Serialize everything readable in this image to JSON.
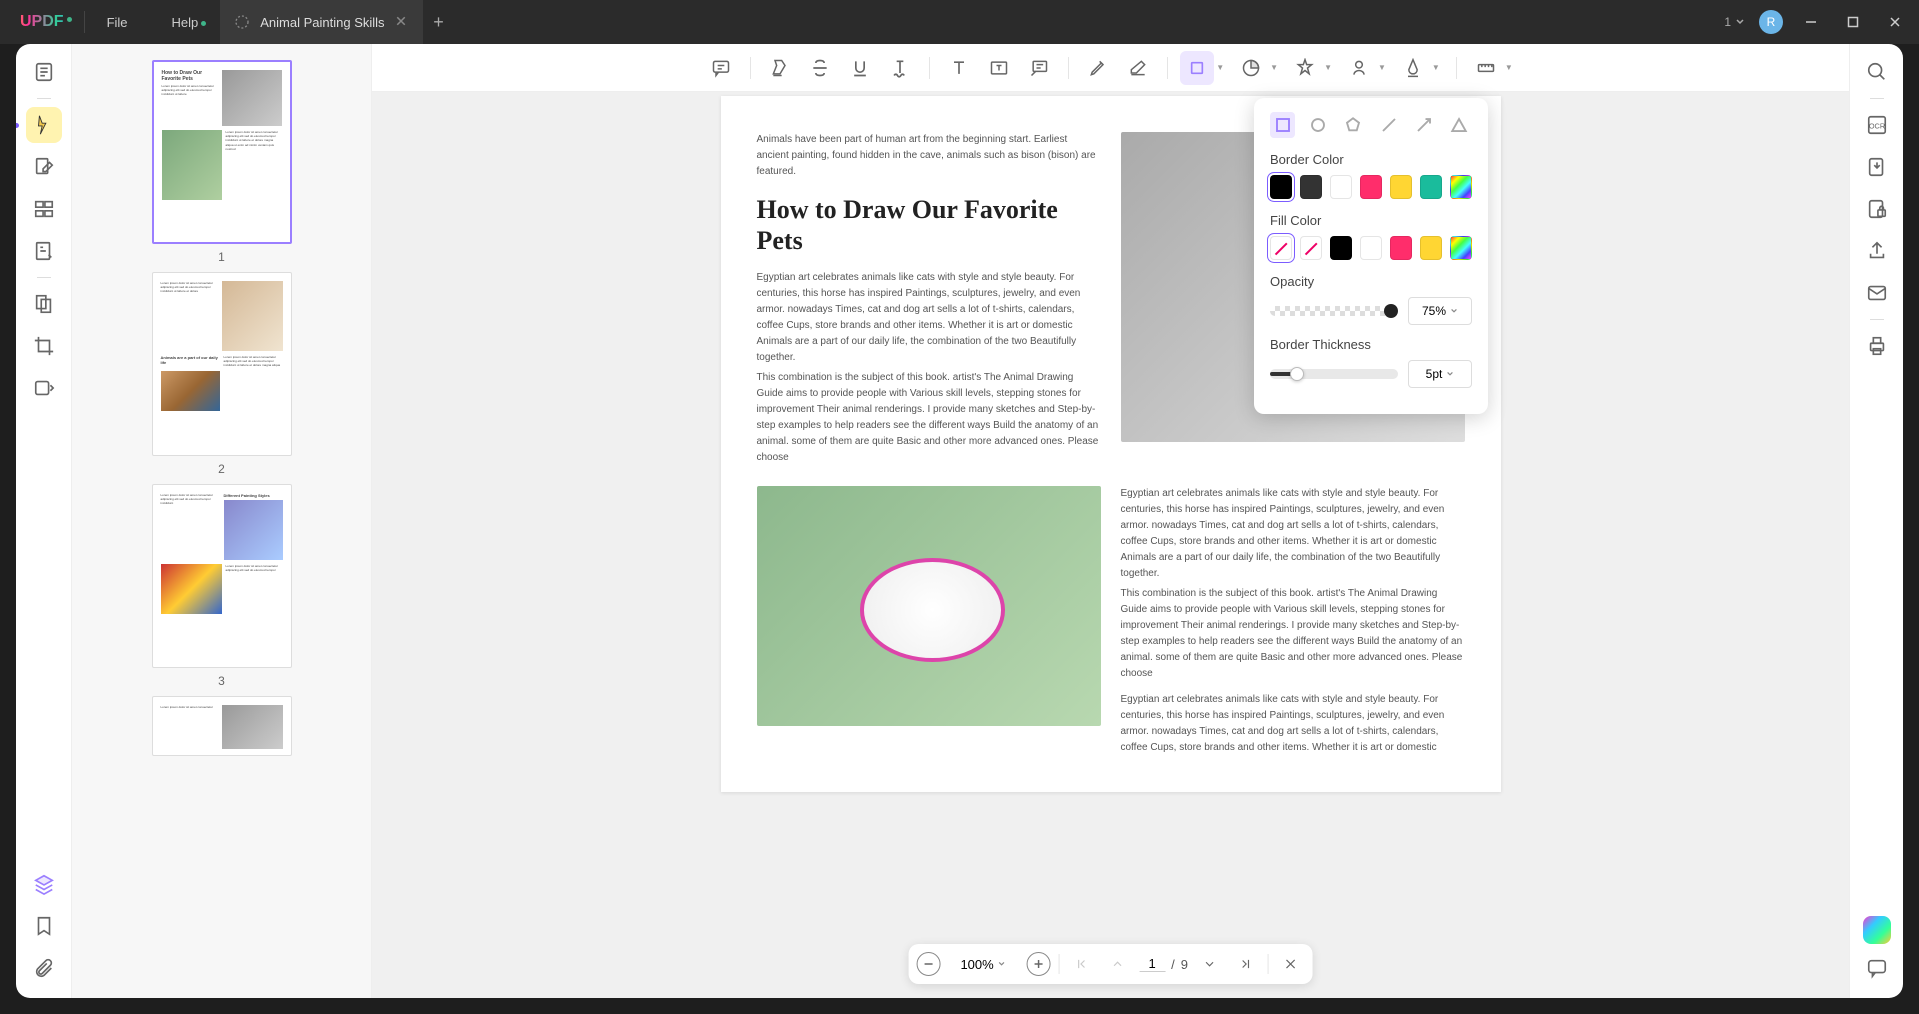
{
  "app": {
    "logo": "UPDF"
  },
  "menu": {
    "file": "File",
    "help": "Help"
  },
  "tab": {
    "title": "Animal Painting Skills"
  },
  "titlebar_right": {
    "dropdown_label": "1",
    "avatar_letter": "R"
  },
  "thumbnails": [
    {
      "num": "1",
      "selected": true
    },
    {
      "num": "2",
      "selected": false
    },
    {
      "num": "3",
      "selected": false
    }
  ],
  "document": {
    "intro": "Animals have been part of human art from the beginning start. Earliest ancient painting, found hidden in the cave, animals such as bison (bison) are featured.",
    "heading": "How to Draw Our Favorite Pets",
    "body1": "Egyptian art celebrates animals like cats with style and style beauty. For centuries, this horse has inspired Paintings, sculptures, jewelry, and even armor. nowadays Times, cat and dog art sells a lot of t-shirts, calendars, coffee Cups, store brands and other items. Whether it is art or domestic Animals are a part of our daily life, the combination of the two Beautifully together.",
    "body2": "This combination is the subject of this book. artist's The Animal Drawing Guide aims to provide people with Various skill levels, stepping stones for improvement Their animal renderings. I provide many sketches and Step-by-step examples to help readers see the different ways Build the anatomy of an animal. some of them are quite Basic and other more advanced ones. Please choose",
    "body3": "Egyptian art celebrates animals like cats with style and style beauty. For centuries, this horse has inspired Paintings, sculptures, jewelry, and even armor. nowadays Times, cat and dog art sells a lot of t-shirts, calendars, coffee Cups, store brands and other items. Whether it is art or domestic Animals are a part of our daily life, the combination of the two Beautifully together.",
    "body4": "This combination is the subject of this book. artist's The Animal Drawing Guide aims to provide people with Various skill levels, stepping stones for improvement Their animal renderings. I provide many sketches and Step-by-step examples to help readers see the different ways Build the anatomy of an animal. some of them are quite Basic and other more advanced ones. Please choose",
    "body5": "Egyptian art celebrates animals like cats with style and style beauty. For centuries, this horse has inspired Paintings, sculptures, jewelry, and even armor. nowadays Times, cat and dog art sells a lot of t-shirts, calendars, coffee Cups, store brands and other items. Whether it is art or domestic"
  },
  "popup": {
    "border_color_label": "Border Color",
    "fill_color_label": "Fill Color",
    "opacity_label": "Opacity",
    "opacity_value": "75%",
    "thickness_label": "Border Thickness",
    "thickness_value": "5pt",
    "border_colors": [
      "#000000",
      "#333333",
      "#ffffff",
      "#ff2d6b",
      "#ffd633",
      "#1abc9c",
      "rainbow"
    ],
    "fill_colors": [
      "none",
      "none",
      "#000000",
      "#ffffff",
      "#ff2d6b",
      "#ffd633",
      "rainbow"
    ]
  },
  "page_nav": {
    "zoom": "100%",
    "current": "1",
    "separator": "/",
    "total": "9"
  }
}
